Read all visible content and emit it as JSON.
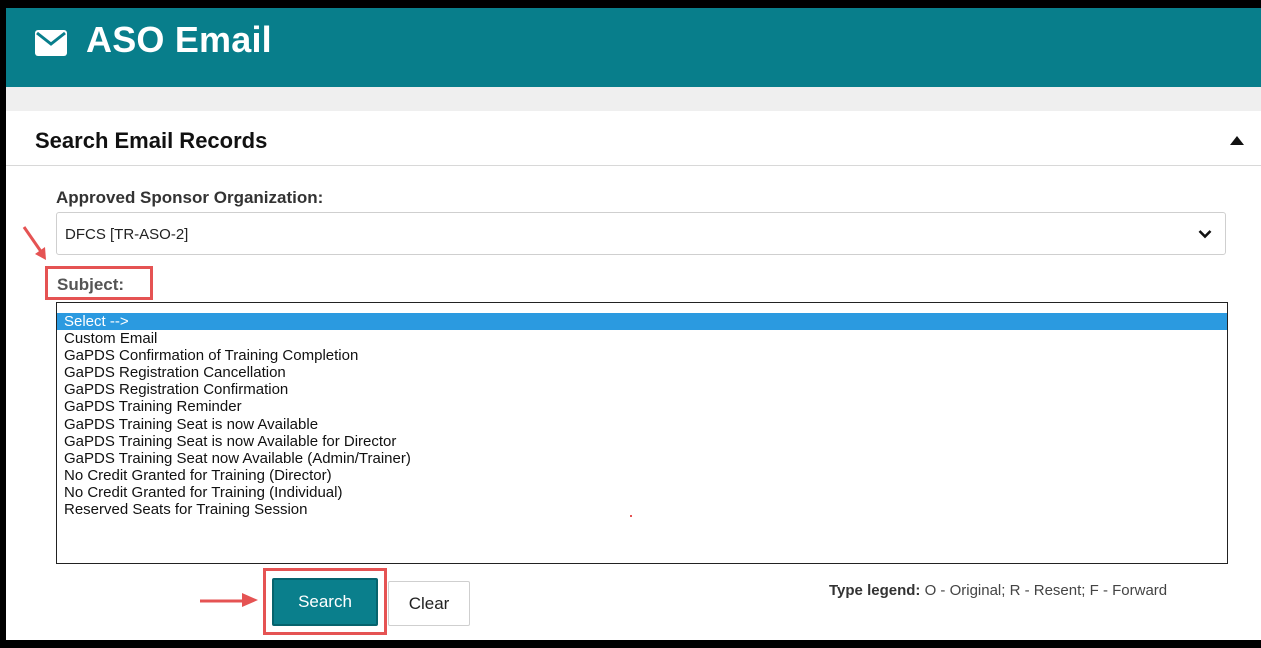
{
  "header": {
    "title": "ASO Email",
    "icon": "envelope-icon",
    "color": "#087e8b"
  },
  "panel": {
    "title": "Search Email Records",
    "toggle_icon": "caret-up-icon"
  },
  "aso": {
    "label": "Approved Sponsor Organization:",
    "value": "DFCS [TR-ASO-2]"
  },
  "subject": {
    "label": "Subject:",
    "options": [
      "Select -->",
      "Custom Email",
      "GaPDS Confirmation of Training Completion",
      "GaPDS Registration Cancellation",
      "GaPDS Registration Confirmation",
      "GaPDS Training Reminder",
      "GaPDS Training Seat is now Available",
      "GaPDS Training Seat is now Available for Director",
      "GaPDS Training Seat now Available (Admin/Trainer)",
      "No Credit Granted for Training (Director)",
      "No Credit Granted for Training (Individual)",
      "Reserved Seats for Training Session"
    ],
    "selected": "Select -->"
  },
  "actions": {
    "search_label": "Search",
    "clear_label": "Clear"
  },
  "legend": {
    "title": "Type legend:",
    "text": " O - Original; R - Resent; F - Forward"
  },
  "annotation_color": "#e55353"
}
